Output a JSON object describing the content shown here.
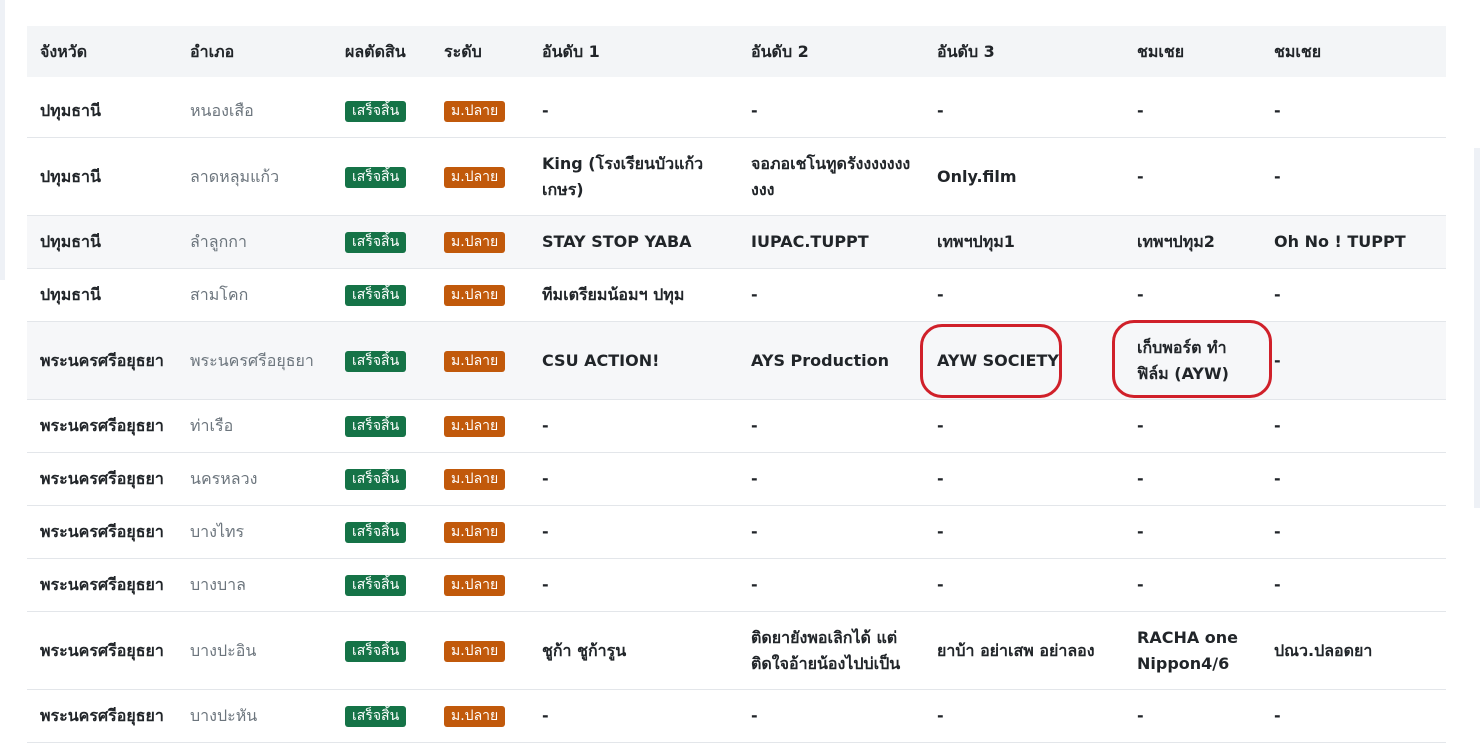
{
  "headers": [
    "จังหวัด",
    "อำเภอ",
    "ผลตัดสิน",
    "ระดับ",
    "อันดับ 1",
    "อันดับ 2",
    "อันดับ 3",
    "ชมเชย",
    "ชมเชย"
  ],
  "rows": [
    {
      "province": "ปทุมธานี",
      "district": "หนองเสือ",
      "status": "เสร็จสิ้น",
      "level": "ม.ปลาย",
      "rank1": "-",
      "rank2": "-",
      "rank3": "-",
      "honor1": "-",
      "honor2": "-"
    },
    {
      "province": "ปทุมธานี",
      "district": "ลาดหลุมแก้ว",
      "status": "เสร็จสิ้น",
      "level": "ม.ปลาย",
      "rank1": "King (โรงเรียนบัวแก้วเกษร)",
      "rank2": "จอภอเชโนทูดรังงงงงงงงงง",
      "rank3": "Only.film",
      "honor1": "-",
      "honor2": "-"
    },
    {
      "province": "ปทุมธานี",
      "district": "ลำลูกกา",
      "status": "เสร็จสิ้น",
      "level": "ม.ปลาย",
      "rank1": "STAY STOP YABA",
      "rank2": "IUPAC.TUPPT",
      "rank3": "เทพฯปทุม1",
      "honor1": "เทพฯปทุม2",
      "honor2": "Oh No ! TUPPT"
    },
    {
      "province": "ปทุมธานี",
      "district": "สามโคก",
      "status": "เสร็จสิ้น",
      "level": "ม.ปลาย",
      "rank1": "ทีมเตรียมน้อมฯ ปทุม",
      "rank2": "-",
      "rank3": "-",
      "honor1": "-",
      "honor2": "-"
    },
    {
      "province": "พระนครศรีอยุธยา",
      "district": "พระนครศรีอยุธยา",
      "status": "เสร็จสิ้น",
      "level": "ม.ปลาย",
      "rank1": "CSU ACTION!",
      "rank2": "AYS Production",
      "rank3": "AYW SOCIETY",
      "honor1": "เก็บพอร์ต ทำฟิล์ม (AYW)",
      "honor2": "-"
    },
    {
      "province": "พระนครศรีอยุธยา",
      "district": "ท่าเรือ",
      "status": "เสร็จสิ้น",
      "level": "ม.ปลาย",
      "rank1": "-",
      "rank2": "-",
      "rank3": "-",
      "honor1": "-",
      "honor2": "-"
    },
    {
      "province": "พระนครศรีอยุธยา",
      "district": "นครหลวง",
      "status": "เสร็จสิ้น",
      "level": "ม.ปลาย",
      "rank1": "-",
      "rank2": "-",
      "rank3": "-",
      "honor1": "-",
      "honor2": "-"
    },
    {
      "province": "พระนครศรีอยุธยา",
      "district": "บางไทร",
      "status": "เสร็จสิ้น",
      "level": "ม.ปลาย",
      "rank1": "-",
      "rank2": "-",
      "rank3": "-",
      "honor1": "-",
      "honor2": "-"
    },
    {
      "province": "พระนครศรีอยุธยา",
      "district": "บางบาล",
      "status": "เสร็จสิ้น",
      "level": "ม.ปลาย",
      "rank1": "-",
      "rank2": "-",
      "rank3": "-",
      "honor1": "-",
      "honor2": "-"
    },
    {
      "province": "พระนครศรีอยุธยา",
      "district": "บางปะอิน",
      "status": "เสร็จสิ้น",
      "level": "ม.ปลาย",
      "rank1": "ชูก้า ชูก้ารูน",
      "rank2": "ติดยายังพอเลิกได้ แต่ติดใจอ้ายน้องไปบ่เป็น",
      "rank3": "ยาบ้า อย่าเสพ อย่าลอง",
      "honor1": "RACHA one Nippon4/6",
      "honor2": "ปณว.ปลอดยา"
    },
    {
      "province": "พระนครศรีอยุธยา",
      "district": "บางปะหัน",
      "status": "เสร็จสิ้น",
      "level": "ม.ปลาย",
      "rank1": "-",
      "rank2": "-",
      "rank3": "-",
      "honor1": "-",
      "honor2": "-"
    }
  ],
  "colors": {
    "status_badge": "#157347",
    "level_badge": "#c1590b",
    "highlight": "#d0202a",
    "header_bg": "#f3f5f7"
  }
}
